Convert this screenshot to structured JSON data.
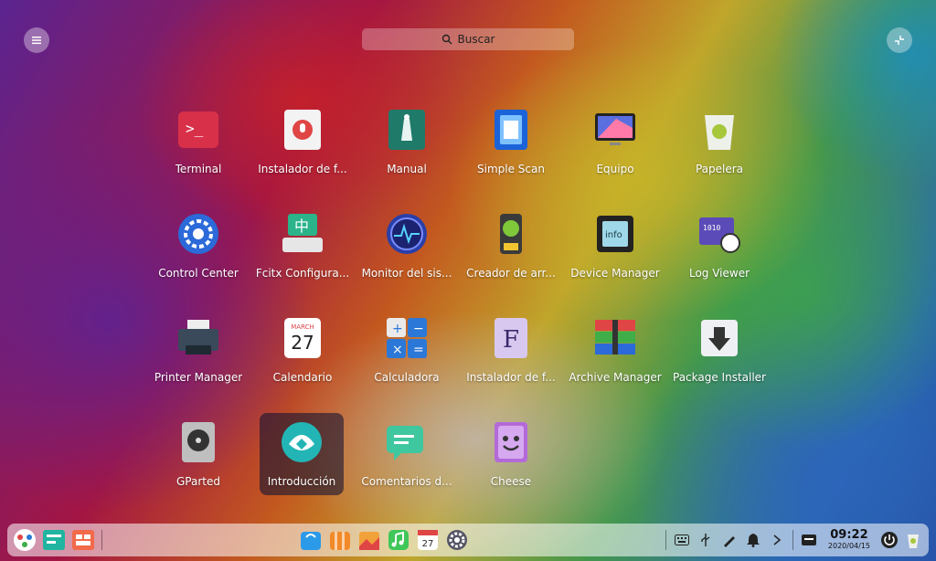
{
  "search": {
    "label": "Buscar"
  },
  "apps": [
    {
      "label": "Terminal",
      "icon": "terminal-icon"
    },
    {
      "label": "Instalador de f...",
      "icon": "installer-icon"
    },
    {
      "label": "Manual",
      "icon": "manual-icon"
    },
    {
      "label": "Simple Scan",
      "icon": "scan-icon"
    },
    {
      "label": "Equipo",
      "icon": "computer-icon"
    },
    {
      "label": "Papelera",
      "icon": "trash-icon"
    },
    {
      "label": "Control Center",
      "icon": "control-center-icon"
    },
    {
      "label": "Fcitx Configura...",
      "icon": "fcitx-icon"
    },
    {
      "label": "Monitor del sis...",
      "icon": "system-monitor-icon"
    },
    {
      "label": "Creador de arr...",
      "icon": "boot-maker-icon"
    },
    {
      "label": "Device Manager",
      "icon": "device-manager-icon"
    },
    {
      "label": "Log Viewer",
      "icon": "log-viewer-icon"
    },
    {
      "label": "Printer Manager",
      "icon": "printer-icon"
    },
    {
      "label": "Calendario",
      "icon": "calendar-icon"
    },
    {
      "label": "Calculadora",
      "icon": "calculator-icon"
    },
    {
      "label": "Instalador de f...",
      "icon": "font-installer-icon"
    },
    {
      "label": "Archive Manager",
      "icon": "archive-icon"
    },
    {
      "label": "Package Installer",
      "icon": "package-icon"
    },
    {
      "label": "GParted",
      "icon": "gparted-icon"
    },
    {
      "label": "Introducción",
      "icon": "introduction-icon"
    },
    {
      "label": "Comentarios d...",
      "icon": "feedback-icon"
    },
    {
      "label": "Cheese",
      "icon": "cheese-icon"
    }
  ],
  "calendar_icon": {
    "month": "MARCH",
    "day": "27"
  },
  "dock": {
    "calendar_day": "27"
  },
  "clock": {
    "time": "09:22",
    "date": "2020/04/15"
  }
}
